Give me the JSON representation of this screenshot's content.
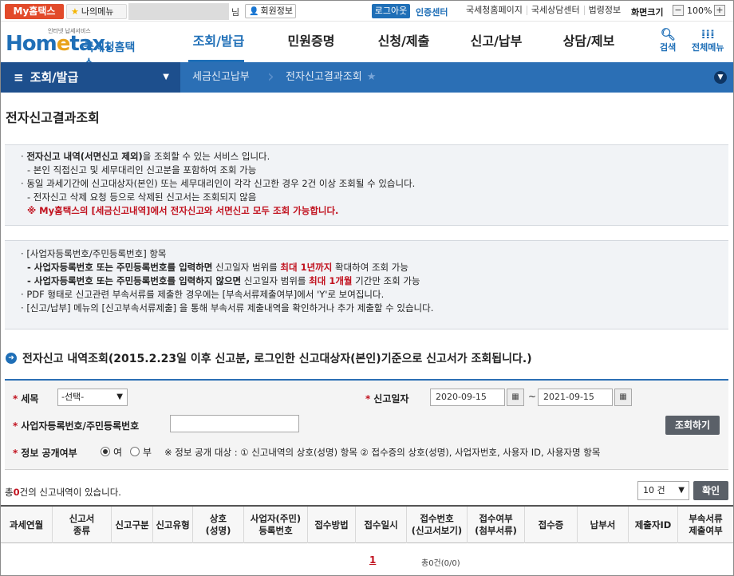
{
  "topbar": {
    "myhometax": "My홈택스",
    "mymenu": "나의메뉴",
    "user_suffix": "님",
    "member_info": "회원정보",
    "logout": "로그아웃",
    "cert_center": "인증센터",
    "links": [
      "국세청홈페이지",
      "국세상담센터",
      "법령정보"
    ],
    "zoom_label": "화면크기",
    "zoom_minus": "−",
    "zoom_value": "100%",
    "zoom_plus": "+"
  },
  "header": {
    "logo_sub": "인터넷 납세서비스",
    "logo_brand_pre": "Hom",
    "logo_brand_e": "e",
    "logo_brand_post": "tax.",
    "logo_kor": "국세청홈택스",
    "nav": [
      "조회/발급",
      "민원증명",
      "신청/제출",
      "신고/납부",
      "상담/제보"
    ],
    "search": "검색",
    "allmenu": "전체메뉴"
  },
  "locbar": {
    "home": "조회/발급",
    "crumb1": "세금신고납부",
    "crumb2": "전자신고결과조회"
  },
  "page": {
    "title": "전자신고결과조회"
  },
  "info1": {
    "l1_bold": "전자신고 내역(서면신고 제외)",
    "l1_rest": "을 조회할 수 있는 서비스 입니다.",
    "l2": "- 본인 직접신고 및 세무대리인 신고분을 포함하여 조회 가능",
    "l3": "동일 과세기간에 신고대상자(본인) 또는 세무대리인이 각각 신고한 경우 2건 이상 조회될 수 있습니다.",
    "l4": "- 전자신고 삭제 요청 등으로 삭제된 신고서는 조회되지 않음",
    "l5": "※ My홈택스의 [세금신고내역]에서 전자신고와 서면신고 모두 조회 가능합니다."
  },
  "info2": {
    "l1": "[사업자등록번호/주민등록번호] 항목",
    "l2_bold": "- 사업자등록번호 또는 주민등록번호를 입력하면",
    "l2_mid": " 신고일자 범위를 ",
    "l2_red": "최대 1년까지",
    "l2_end": " 확대하여 조회 가능",
    "l3_bold": "- 사업자등록번호 또는 주민등록번호를 입력하지 않으면",
    "l3_mid": " 신고일자 범위를 ",
    "l3_red": "최대 1개월",
    "l3_end": " 기간만 조회 가능",
    "l4": "PDF 형태로 신고관련 부속서류를 제출한 경우에는 [부속서류제출여부]에서 'Y'로 보여집니다.",
    "l5": "[신고/납부] 메뉴의 [신고부속서류제출] 을 통해 부속서류 제출내역을 확인하거나 추가 제출할 수 있습니다."
  },
  "section": {
    "title": "전자신고 내역조회(2015.2.23일 이후 신고분, 로그인한  신고대상자(본인)기준으로  신고서가 조회됩니다.)"
  },
  "form": {
    "tax_label": "세목",
    "tax_value": "-선택-",
    "date_label": "신고일자",
    "date_from": "2020-09-15",
    "date_tilde": "~",
    "date_to": "2021-09-15",
    "regno_label": "사업자등록번호/주민등록번호",
    "regno_value": "",
    "search_btn": "조회하기",
    "disclose_label": "정보 공개여부",
    "yes": "여",
    "no": "부",
    "disclose_selected": "여",
    "note": "※ 정보 공개 대상 : ① 신고내역의 상호(성명) 항목 ② 접수증의 상호(성명), 사업자번호, 사용자 ID, 사용자명 항목"
  },
  "results": {
    "prefix": "총",
    "count": "0",
    "suffix": "건의 신고내역이 있습니다.",
    "page_size": "10 건",
    "confirm": "확인"
  },
  "table": {
    "headers": [
      "과세연월",
      "신고서\n종류",
      "신고구분",
      "신고유형",
      "상호\n(성명)",
      "사업자(주민)\n등록번호",
      "접수방법",
      "접수일시",
      "접수번호\n(신고서보기)",
      "접수여부\n(첨부서류)",
      "접수증",
      "납부서",
      "제출자ID",
      "부속서류\n제출여부"
    ]
  },
  "pager": {
    "current": "1",
    "total": "총0건(0/0)"
  },
  "colors": {
    "brand_blue": "#1f6fb7",
    "loc_dark": "#1d4f8d",
    "loc_bar": "#2b6fb5",
    "alert_red": "#c1121f",
    "myhometax_red": "#e24a2a"
  }
}
